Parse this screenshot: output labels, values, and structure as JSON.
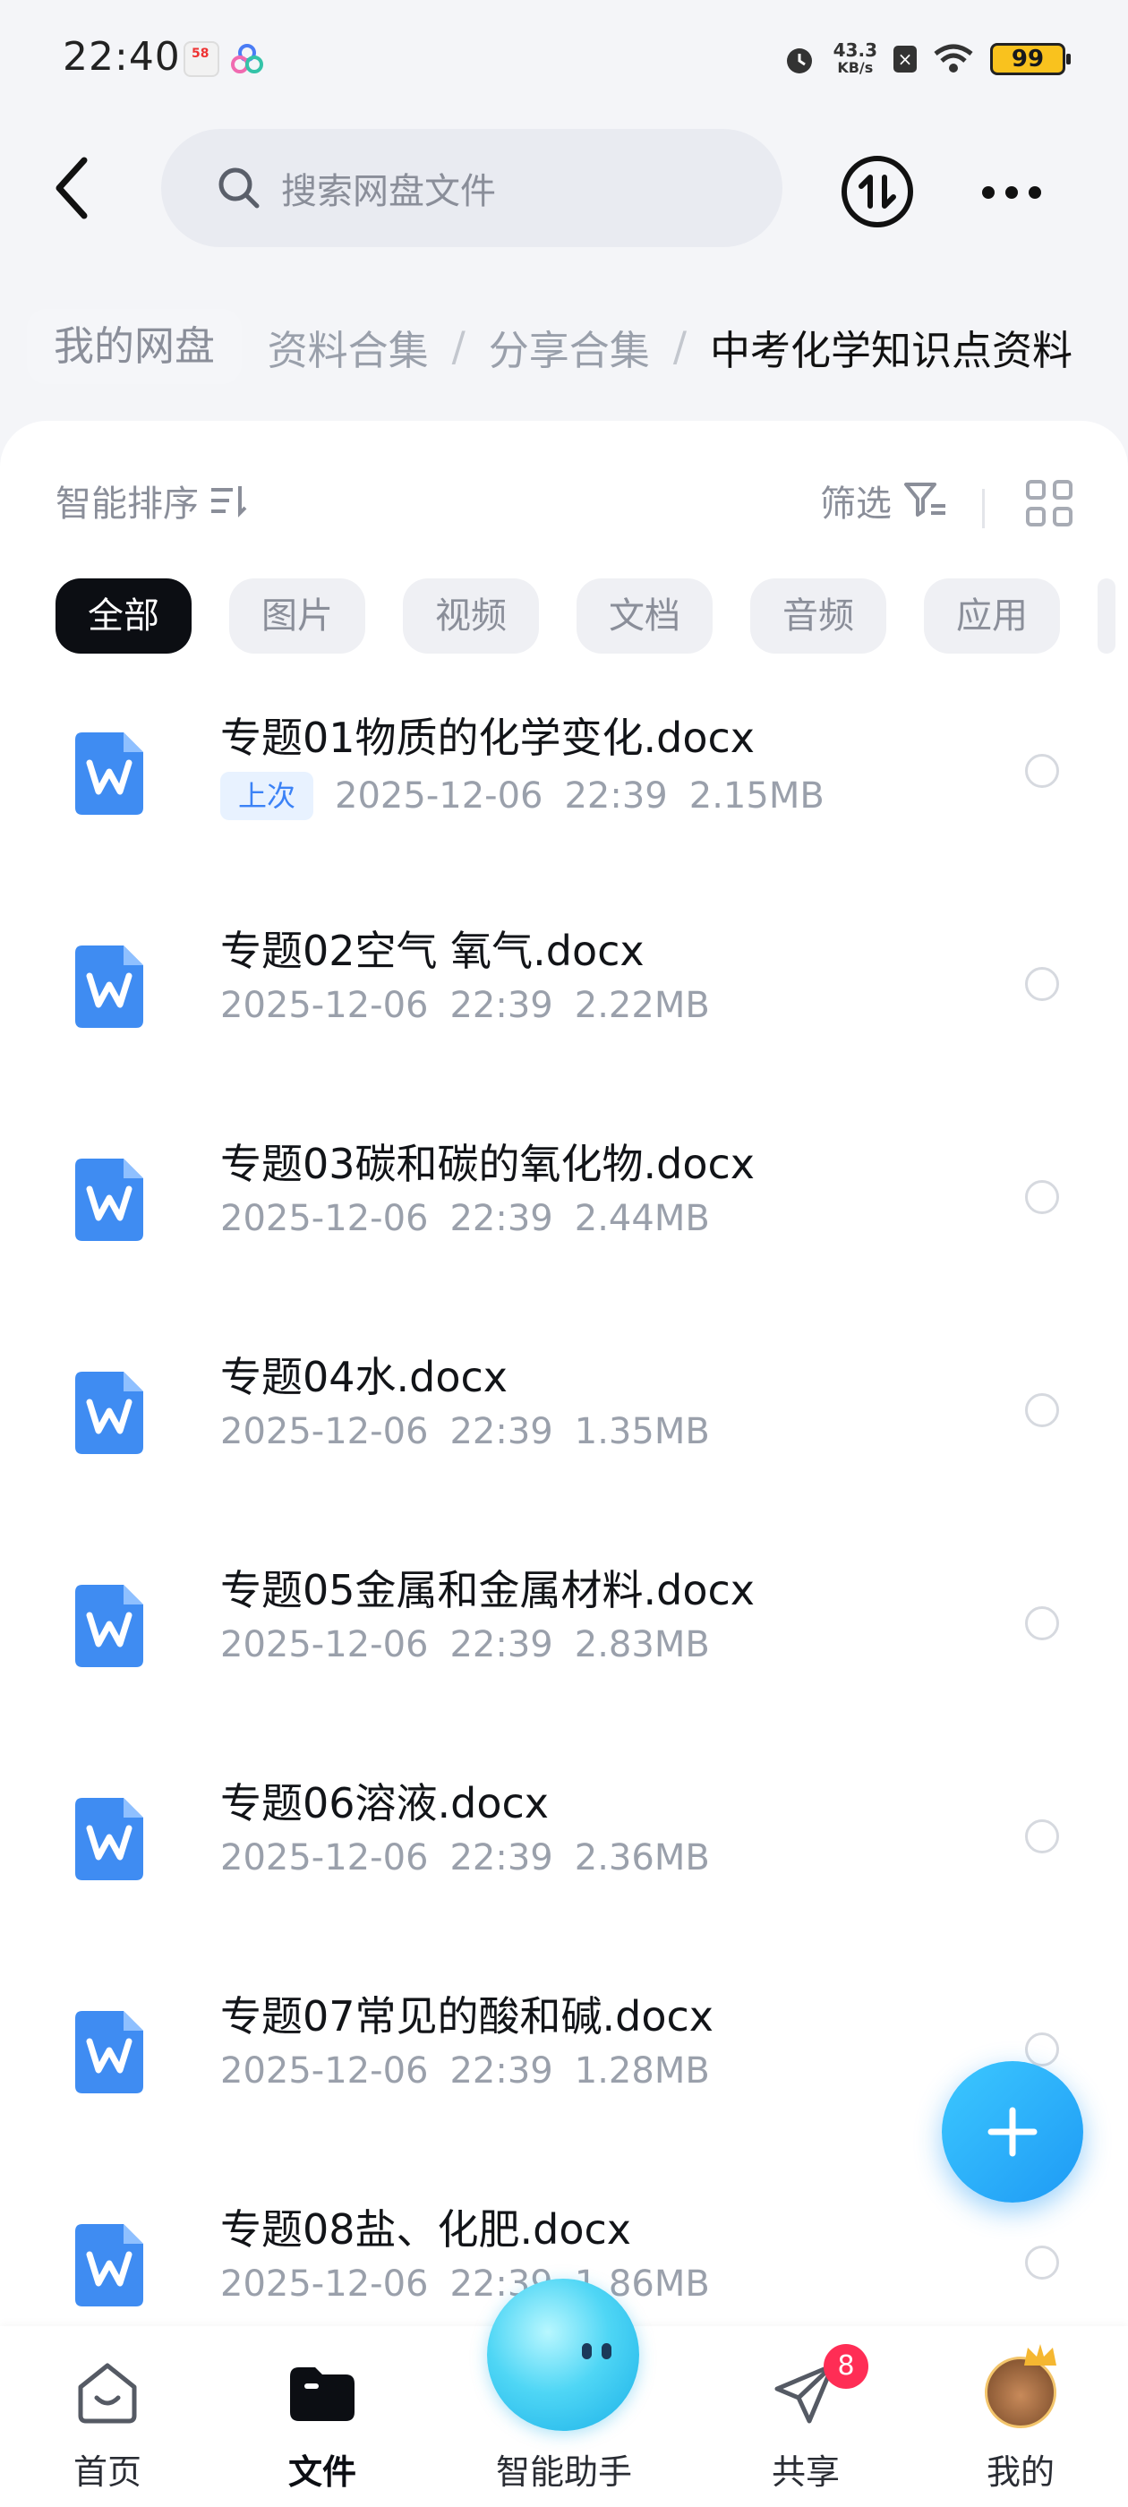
{
  "status_bar": {
    "time": "22:40",
    "net_speed_value": "43.3",
    "net_speed_unit": "KB/s",
    "battery": "99"
  },
  "header": {
    "search_placeholder": "搜索网盘文件"
  },
  "breadcrumb": {
    "root": "我的网盘",
    "trail": [
      "资料合集",
      "分享合集"
    ],
    "current": "中考化学知识点资料"
  },
  "toolbar": {
    "sort_label": "智能排序",
    "filter_label": "筛选"
  },
  "chips": [
    "全部",
    "图片",
    "视频",
    "文档",
    "音频",
    "应用"
  ],
  "files": [
    {
      "name": "专题01物质的化学变化.docx",
      "badge": "上次",
      "date": "2025-12-06",
      "time": "22:39",
      "size": "2.15MB"
    },
    {
      "name": "专题02空气 氧气.docx",
      "date": "2025-12-06",
      "time": "22:39",
      "size": "2.22MB"
    },
    {
      "name": "专题03碳和碳的氧化物.docx",
      "date": "2025-12-06",
      "time": "22:39",
      "size": "2.44MB"
    },
    {
      "name": "专题04水.docx",
      "date": "2025-12-06",
      "time": "22:39",
      "size": "1.35MB"
    },
    {
      "name": "专题05金属和金属材料.docx",
      "date": "2025-12-06",
      "time": "22:39",
      "size": "2.83MB"
    },
    {
      "name": "专题06溶液.docx",
      "date": "2025-12-06",
      "time": "22:39",
      "size": "2.36MB"
    },
    {
      "name": "专题07常见的酸和碱.docx",
      "date": "2025-12-06",
      "time": "22:39",
      "size": "1.28MB"
    },
    {
      "name": "专题08盐、化肥.docx",
      "date": "2025-12-06",
      "time": "22:39",
      "size": "1.86MB"
    }
  ],
  "bottom_nav": {
    "home": "首页",
    "files": "文件",
    "assistant": "智能助手",
    "share": "共享",
    "share_badge": "8",
    "mine": "我的"
  },
  "colors": {
    "accent": "#3b82f6",
    "fab": "#1e9af5",
    "badge": "#ff2d55"
  }
}
